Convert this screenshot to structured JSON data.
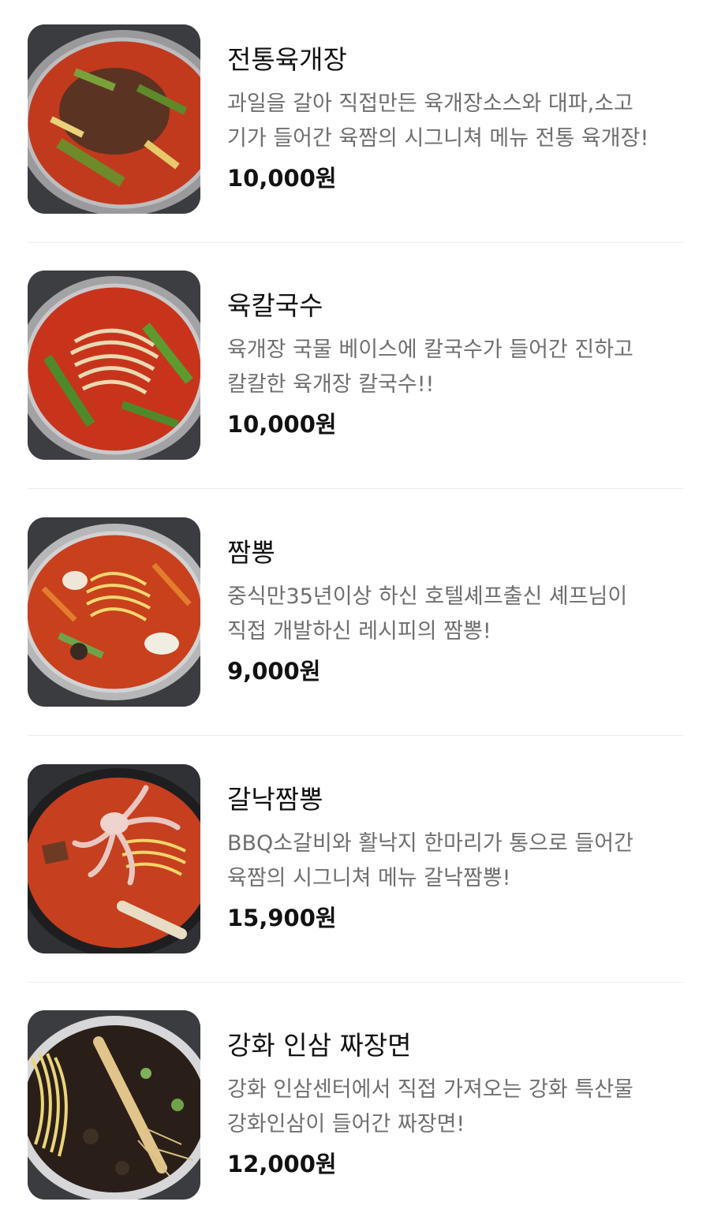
{
  "menu": {
    "items": [
      {
        "name": "전통육개장",
        "desc_line1": "과일을 갈아 직접만든 육개장소스와 대파,소고",
        "desc_line2": "기가 들어간 육짬의 시그니쳐 메뉴 전통 육개장!",
        "price": "10,000원",
        "image_icon": "yukgaejang-photo"
      },
      {
        "name": "육칼국수",
        "desc_line1": "육개장 국물 베이스에 칼국수가 들어간 진하고",
        "desc_line2": "칼칼한 육개장 칼국수!!",
        "price": "10,000원",
        "image_icon": "yuk-kalguksu-photo"
      },
      {
        "name": "짬뽕",
        "desc_line1": "중식만35년이상 하신 호텔셰프출신 셰프님이",
        "desc_line2": "직접 개발하신 레시피의 짬뽕!",
        "price": "9,000원",
        "image_icon": "jjamppong-photo"
      },
      {
        "name": "갈낙짬뽕",
        "desc_line1": "BBQ소갈비와 활낙지 한마리가 통으로 들어간",
        "desc_line2": "육짬의 시그니쳐 메뉴 갈낙짬뽕!",
        "price": "15,900원",
        "image_icon": "galnak-jjamppong-photo"
      },
      {
        "name": "강화 인삼 짜장면",
        "desc_line1": "강화 인삼센터에서 직접 가져오는 강화 특산물",
        "desc_line2": "강화인삼이 들어간 짜장면!",
        "price": "12,000원",
        "image_icon": "ginseng-jajangmyeon-photo"
      }
    ]
  },
  "colors": {
    "name_text": "#111111",
    "desc_text": "#6f6f6f",
    "price_text": "#111111",
    "divider": "#ececec",
    "soup_red": "#c8341b"
  }
}
